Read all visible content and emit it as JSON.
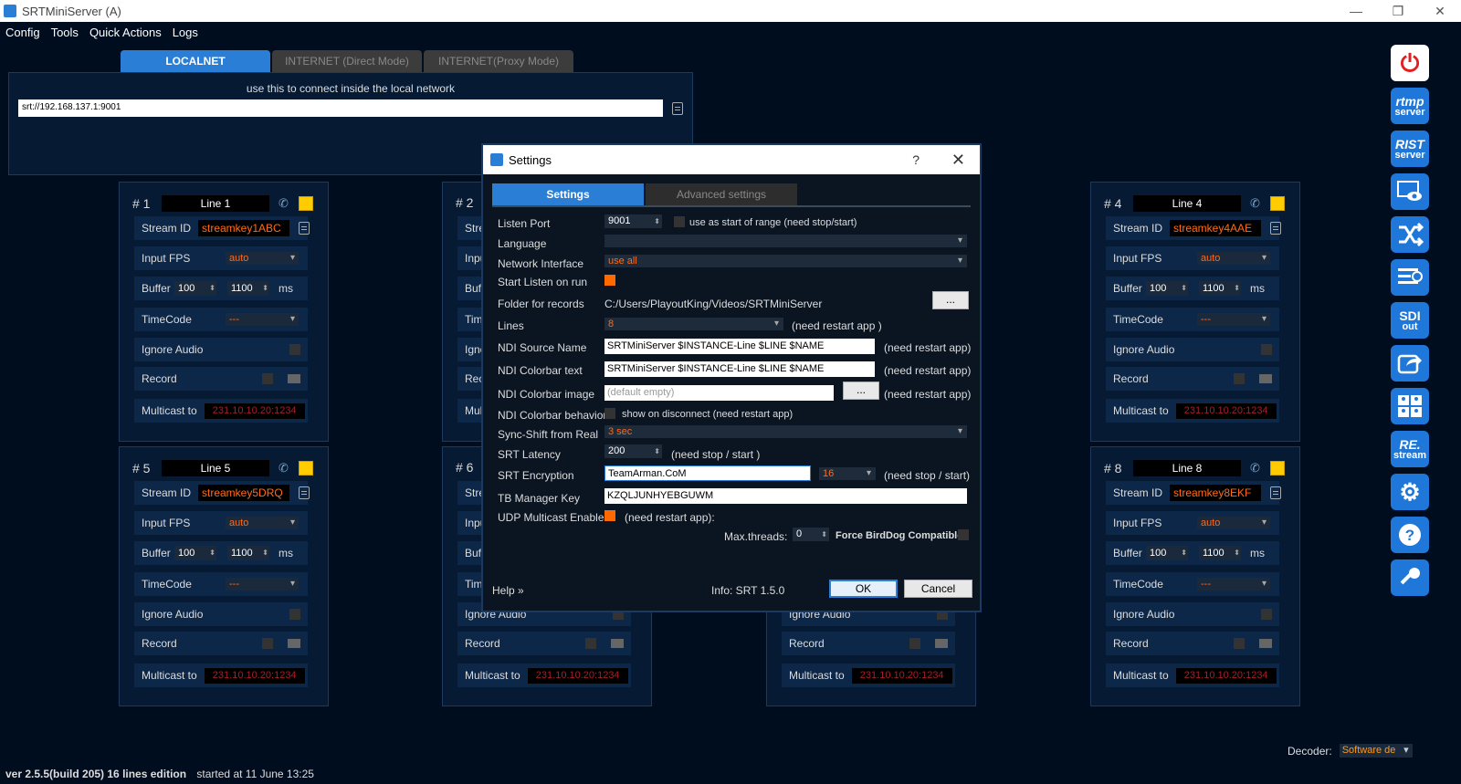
{
  "window": {
    "title": "SRTMiniServer (A)"
  },
  "menu": [
    "Config",
    "Tools",
    "Quick Actions",
    "Logs"
  ],
  "net_tabs": [
    "LOCALNET",
    "INTERNET (Direct Mode)",
    "INTERNET(Proxy Mode)"
  ],
  "net_panel": {
    "hint": "use this to connect inside the local network",
    "url": "srt://192.168.137.1:9001"
  },
  "row_labels": {
    "stream_id": "Stream ID",
    "input_fps": "Input FPS",
    "buffer": "Buffer",
    "ms": "ms",
    "timecode": "TimeCode",
    "ignore_audio": "Ignore Audio",
    "record": "Record",
    "multicast": "Multicast to"
  },
  "lines": [
    {
      "num": "# 1",
      "name": "Line 1",
      "stream_id": "streamkey1ABC",
      "fps": "auto",
      "buf1": "100",
      "buf2": "1100",
      "timecode": "---",
      "multicast": "231.10.10.20:1234"
    },
    {
      "num": "# 2",
      "name": "",
      "stream_id": "",
      "fps": "",
      "buf1": "",
      "buf2": "",
      "timecode": "",
      "multicast": ""
    },
    {
      "num": "# 4",
      "name": "Line 4",
      "stream_id": "streamkey4AAE",
      "fps": "auto",
      "buf1": "100",
      "buf2": "1100",
      "timecode": "---",
      "multicast": "231.10.10.20:1234"
    },
    {
      "num": "# 5",
      "name": "Line 5",
      "stream_id": "streamkey5DRQ",
      "fps": "auto",
      "buf1": "100",
      "buf2": "1100",
      "timecode": "---",
      "multicast": "231.10.10.20:1234"
    },
    {
      "num": "# 6",
      "name": "",
      "stream_id": "",
      "fps": "",
      "buf1": "",
      "buf2": "",
      "timecode": "",
      "multicast": "231.10.10.20:1234"
    },
    {
      "num": "",
      "name": "",
      "stream_id": "",
      "fps": "",
      "buf1": "",
      "buf2": "",
      "timecode": "",
      "multicast": "231.10.10.20:1234"
    },
    {
      "num": "# 8",
      "name": "Line 8",
      "stream_id": "streamkey8EKF",
      "fps": "auto",
      "buf1": "100",
      "buf2": "1100",
      "timecode": "---",
      "multicast": "231.10.10.20:1234"
    }
  ],
  "sidebar": {
    "rtmp": [
      "rtmp",
      "server"
    ],
    "rist": [
      "RIST",
      "server"
    ],
    "sdi": [
      "SDI",
      "out"
    ],
    "restream": [
      "RE.",
      "stream"
    ],
    "icons": [
      "power-icon",
      "rtmp-server-icon",
      "rist-server-icon",
      "image-preview-icon",
      "shuffle-icon",
      "list-clock-icon",
      "sdi-out-icon",
      "share-icon",
      "users-grid-icon",
      "restream-icon",
      "settings-gear-icon",
      "help-icon",
      "key-icon"
    ]
  },
  "status": {
    "version": "ver 2.5.5(build 205) 16 lines edition",
    "started": "started at 11 June 13:25"
  },
  "decoder": {
    "label": "Decoder:",
    "value": "Software de"
  },
  "dialog": {
    "title": "Settings",
    "help_glyph": "?",
    "close_glyph": "✕",
    "tabs": [
      "Settings",
      "Advanced settings"
    ],
    "labels": {
      "listen_port": "Listen Port",
      "language": "Language",
      "network_interface": "Network Interface",
      "start_listen": "Start Listen on run",
      "folder": "Folder for records",
      "lines": "Lines",
      "ndi_source": "NDI Source Name",
      "ndi_colorbar_text": "NDI Colorbar text",
      "ndi_colorbar_image": "NDI Colorbar image",
      "ndi_colorbar_behavior": "NDI Colorbar behavior",
      "sync_shift": "Sync-Shift from Real",
      "srt_latency": "SRT Latency",
      "srt_encryption": "SRT Encryption",
      "tb_manager_key": "TB Manager Key",
      "udp_multicast": "UDP Multicast Enable",
      "max_threads": "Max.threads:",
      "force_birddog": "Force BirdDog Compatible:"
    },
    "values": {
      "listen_port": "9001",
      "listen_range_note": "use as start of range (need stop/start)",
      "language": "",
      "network_interface": "use all",
      "folder": "C:/Users/PlayoutKing/Videos/SRTMiniServer",
      "lines": "8",
      "lines_note": "(need restart app )",
      "ndi_source": "SRTMiniServer $INSTANCE-Line $LINE $NAME",
      "ndi_colorbar_text": "SRTMiniServer $INSTANCE-Line $LINE $NAME",
      "ndi_colorbar_image_placeholder": "(default empty)",
      "restart_note": "(need restart app)",
      "behavior_note": "show on disconnect (need restart app)",
      "sync_shift": "3 sec",
      "srt_latency": "200",
      "stop_start_note": "(need stop / start )",
      "srt_encryption": "TeamArman.CoM",
      "key_length": "16",
      "stop_start_note2": "(need stop / start)",
      "tb_manager_key": "KZQLJUNHYEBGUWM",
      "udp_note": "(need restart app):",
      "max_threads": "0"
    },
    "browse": "...",
    "help_link": "Help »",
    "info": "Info: SRT 1.5.0",
    "ok": "OK",
    "cancel": "Cancel"
  }
}
